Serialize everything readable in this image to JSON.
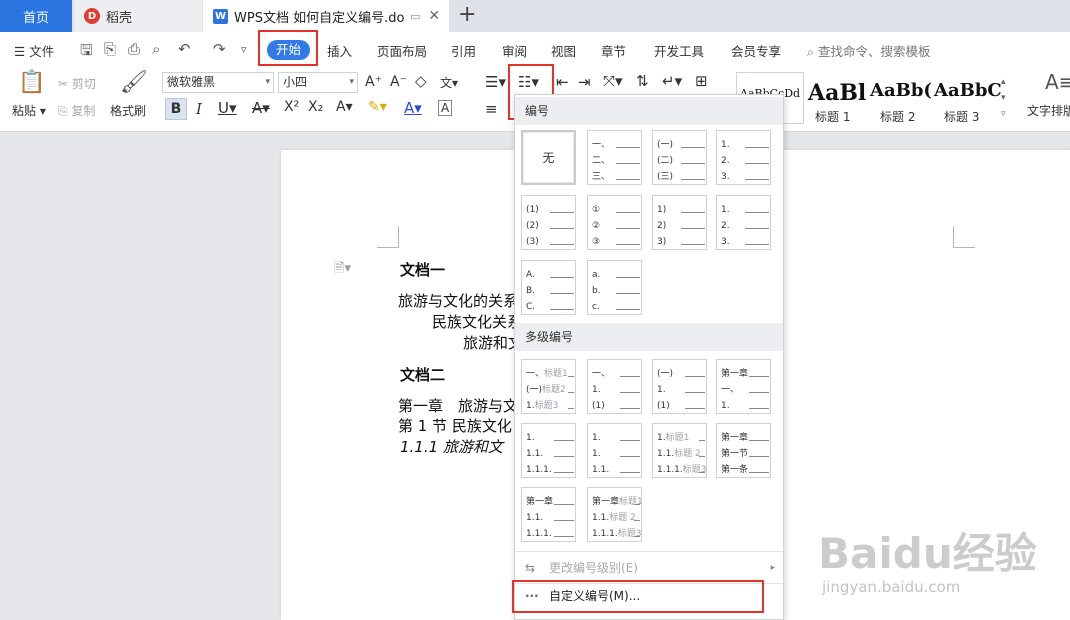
{
  "tabs": {
    "home": "首页",
    "daoke": "稻壳",
    "doc": "WPS文档 如何自定义编号.docx"
  },
  "menu": {
    "file": "文件",
    "start": "开始",
    "items": [
      "插入",
      "页面布局",
      "引用",
      "审阅",
      "视图",
      "章节",
      "开发工具",
      "会员专享"
    ],
    "search": "查找命令、搜索模板"
  },
  "ribbon": {
    "paste": "粘贴",
    "cut": "剪切",
    "copy": "复制",
    "format_painter": "格式刷",
    "font_name": "微软雅黑",
    "font_size": "小四",
    "styles": [
      {
        "preview": "AaBbCcDd",
        "label": ""
      },
      {
        "preview": "AaBl",
        "label": "标题 1"
      },
      {
        "preview": "AaBb(",
        "label": "标题 2"
      },
      {
        "preview": "AaBbC",
        "label": "标题 3"
      }
    ],
    "text_layout": "文字排版"
  },
  "dropdown": {
    "section_numbering": "编号",
    "none_label": "无",
    "single": [
      [
        "一、",
        "二、",
        "三、"
      ],
      [
        "(一)",
        "(二)",
        "(三)"
      ],
      [
        "1.",
        "2.",
        "3."
      ],
      [
        "(1)",
        "(2)",
        "(3)"
      ],
      [
        "①",
        "②",
        "③"
      ],
      [
        "1)",
        "2)",
        "3)"
      ],
      [
        "1.",
        "2.",
        "3."
      ],
      [
        "A.",
        "B.",
        "C."
      ],
      [
        "a.",
        "b.",
        "c."
      ]
    ],
    "section_multilevel": "多级编号",
    "multi": [
      [
        [
          "一、",
          "标题1"
        ],
        [
          "(一)",
          "标题2"
        ],
        [
          "1.",
          "标题3"
        ]
      ],
      [
        [
          "一、",
          ""
        ],
        [
          "1.",
          ""
        ],
        [
          "(1)",
          ""
        ]
      ],
      [
        [
          "(一)",
          ""
        ],
        [
          "1.",
          ""
        ],
        [
          "(1)",
          ""
        ]
      ],
      [
        [
          "第一章",
          ""
        ],
        [
          "一、",
          ""
        ],
        [
          "1.",
          ""
        ]
      ],
      [
        [
          "1.",
          ""
        ],
        [
          "1.1.",
          ""
        ],
        [
          "1.1.1.",
          ""
        ]
      ],
      [
        [
          "1.",
          ""
        ],
        [
          "1.",
          ""
        ],
        [
          "1.1.",
          ""
        ]
      ],
      [
        [
          "1.",
          "标题1"
        ],
        [
          "1.1.",
          "标题 2"
        ],
        [
          "1.1.1.",
          "标题3"
        ]
      ],
      [
        [
          "第一章",
          ""
        ],
        [
          "第一节",
          ""
        ],
        [
          "第一条",
          ""
        ]
      ],
      [
        [
          "第一章",
          ""
        ],
        [
          "1.1.",
          ""
        ],
        [
          "1.1.1.",
          ""
        ]
      ],
      [
        [
          "第一章",
          "标题1"
        ],
        [
          "1.1.",
          "标题 2"
        ],
        [
          "1.1.1.",
          "标题3"
        ]
      ]
    ],
    "change_level": "更改编号级别(E)",
    "custom": "自定义编号(M)..."
  },
  "document": {
    "lines": [
      {
        "text": "文档一",
        "bold": true
      },
      {
        "text": "旅游与文化的关系",
        "bold": false
      },
      {
        "text": "民族文化关系",
        "bold": false
      },
      {
        "text": "旅游和文",
        "bold": false
      },
      {
        "text": "文档二",
        "bold": true
      },
      {
        "text": "第一章　旅游与文",
        "bold": false
      },
      {
        "text": "第 1 节  民族文化",
        "bold": false
      },
      {
        "text": "1.1.1  旅游和文",
        "bold": false
      }
    ]
  },
  "watermark": {
    "brand": "Baidu经验",
    "url": "jingyan.baidu.com"
  },
  "colors": {
    "accent": "#3379e8",
    "highlight_box": "#e5332a",
    "home_tab": "#2b75e1"
  }
}
